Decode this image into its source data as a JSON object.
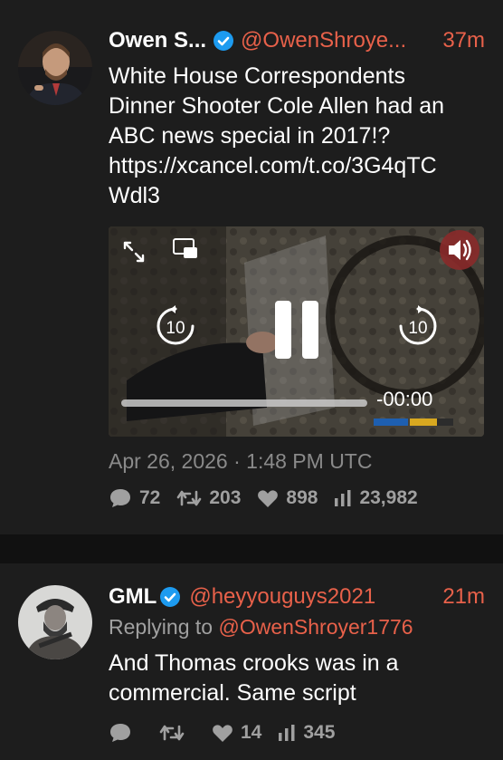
{
  "tweets": [
    {
      "name": "Owen S...",
      "handle": "@OwenShroye...",
      "time": "37m",
      "text": "White House Correspondents\nDinner Shooter Cole Allen had an\nABC news special in 2017!?\nhttps://xcancel.com/t.co/3G4qTC\nWdl3",
      "video": {
        "remaining": "-00:00",
        "skip_back": "10",
        "skip_forward": "10",
        "progress": 1.0
      },
      "timestamp": "Apr 26, 2026 · 1:48 PM UTC",
      "stats": {
        "replies": "72",
        "retweets": "203",
        "likes": "898",
        "views": "23,982"
      }
    },
    {
      "name": "GML",
      "handle": "@heyyouguys2021",
      "time": "21m",
      "replying_to_label": "Replying to ",
      "replying_to_handle": "@OwenShroyer1776",
      "text": "And Thomas crooks was in a\ncommercial. Same script",
      "stats": {
        "replies": "",
        "retweets": "",
        "likes": "14",
        "views": "345"
      }
    }
  ],
  "colors": {
    "accent": "#e8614a",
    "verified": "#1d9bf0",
    "background": "#1d1d1d",
    "muted": "#a0a0a0"
  }
}
